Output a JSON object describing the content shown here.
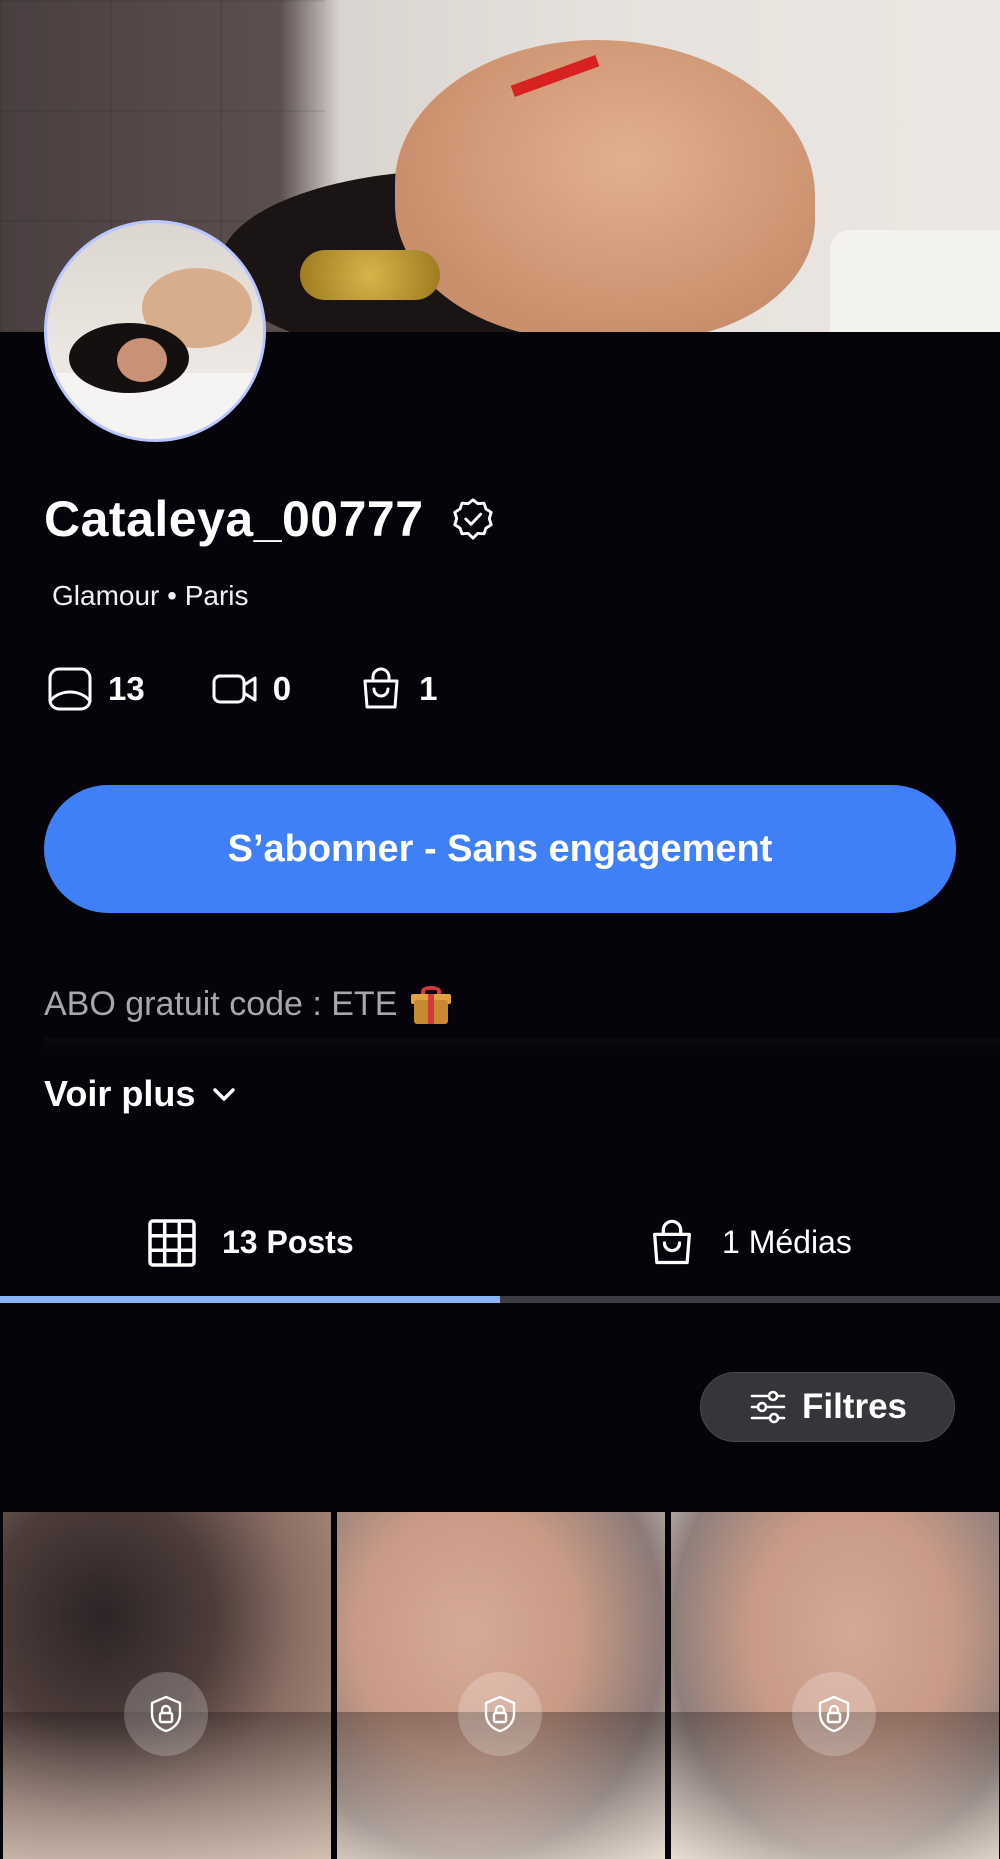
{
  "profile": {
    "username": "Cataleya_00777",
    "subtitle": "Glamour • Paris",
    "bio": "ABO gratuit code : ETE",
    "bio_emoji": "gift-icon"
  },
  "stats": {
    "photos": "13",
    "videos": "0",
    "products": "1"
  },
  "actions": {
    "subscribe_label": "S’abonner - Sans engagement",
    "see_more_label": "Voir plus"
  },
  "tabs": [
    {
      "label": "13 Posts",
      "icon": "grid-icon",
      "active": true
    },
    {
      "label": "1 Médias",
      "icon": "bag-icon",
      "active": false
    }
  ],
  "filters": {
    "label": "Filtres",
    "icon": "sliders-icon"
  },
  "posts": [
    {
      "locked": true
    },
    {
      "locked": true
    },
    {
      "locked": true
    }
  ],
  "colors": {
    "background": "#04040a",
    "accent": "#3f7ff8",
    "tab_indicator": "#8ab4f8",
    "muted_text": "#a6a6ac",
    "avatar_ring": "#b9c6ff"
  }
}
